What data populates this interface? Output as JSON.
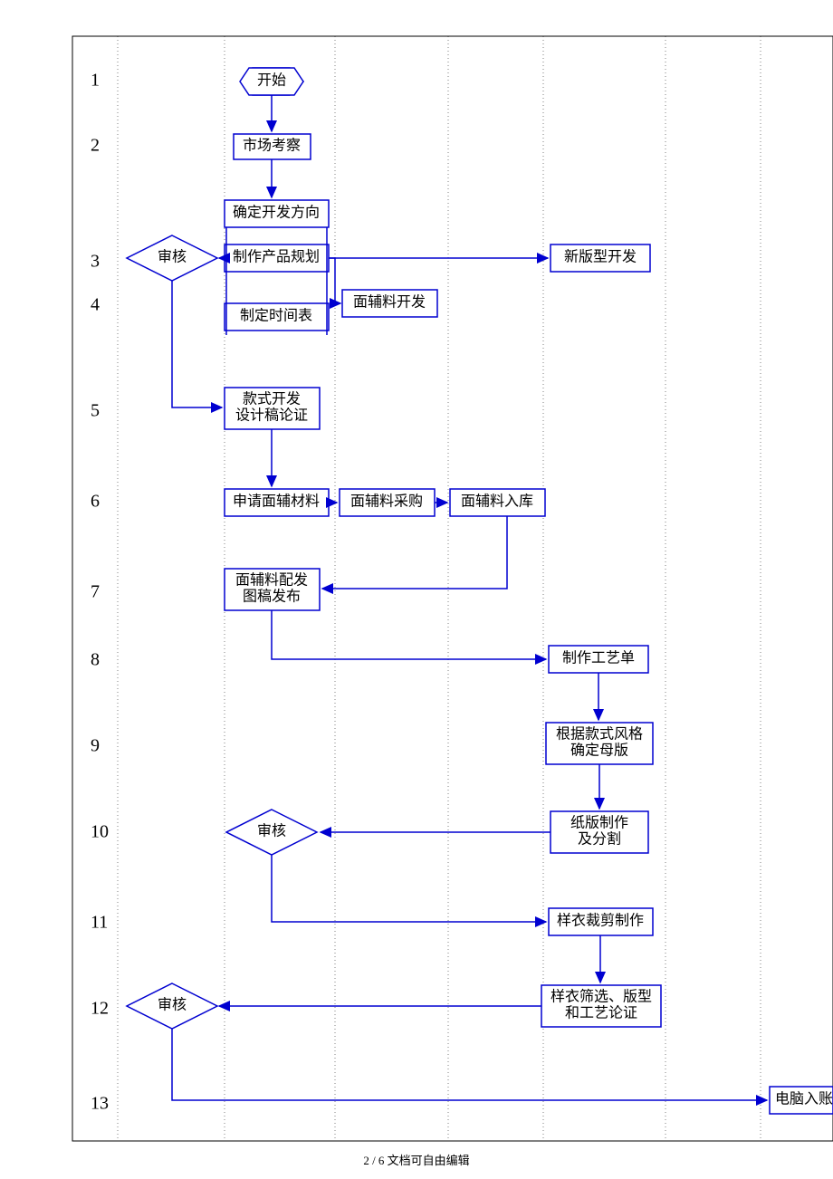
{
  "footer": "2 / 6 文档可自由编辑",
  "rows": [
    "1",
    "2",
    "3",
    "4",
    "5",
    "6",
    "7",
    "8",
    "9",
    "10",
    "11",
    "12",
    "13"
  ],
  "nodes": {
    "start": "开始",
    "market": "市场考察",
    "direction": "确定开发方向",
    "plan": "制作产品规划",
    "schedule": "制定时间表",
    "material_dev": "面辅料开发",
    "newver": "新版型开发",
    "review1": "审核",
    "style_dev_l1": "款式开发",
    "style_dev_l2": "设计稿论证",
    "apply_mat": "申请面辅材料",
    "purchase": "面辅料采购",
    "instock": "面辅料入库",
    "dispatch_l1": "面辅料配发",
    "dispatch_l2": "图稿发布",
    "craft": "制作工艺单",
    "master_l1": "根据款式风格",
    "master_l2": "确定母版",
    "paper_l1": "纸版制作",
    "paper_l2": "及分割",
    "review2": "审核",
    "cut": "样衣裁剪制作",
    "screen_l1": "样衣筛选、版型",
    "screen_l2": "和工艺论证",
    "review3": "审核",
    "computer": "电脑入账"
  }
}
